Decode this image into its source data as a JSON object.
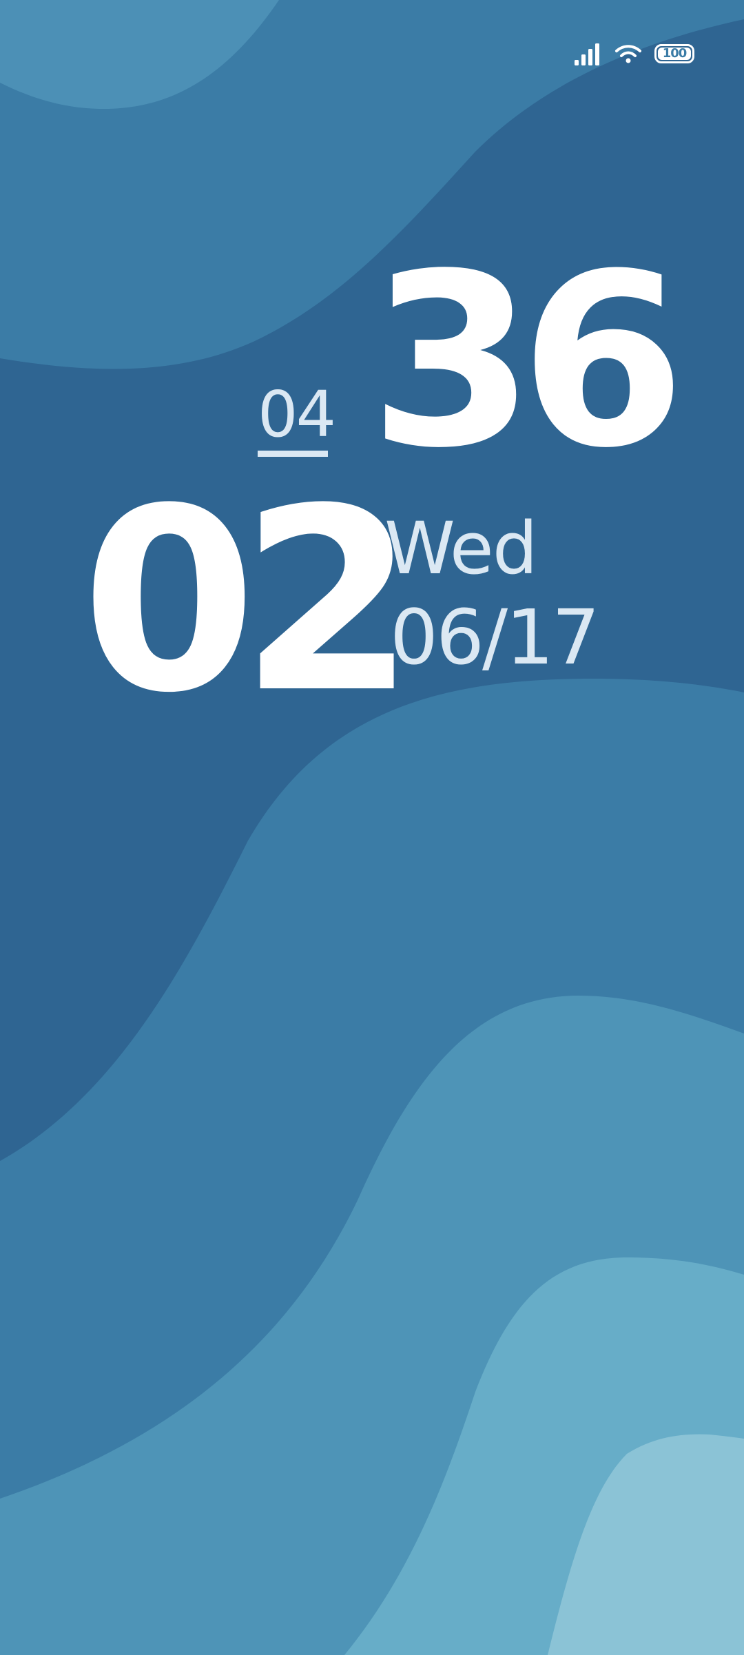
{
  "status_bar": {
    "battery_level": "100",
    "signal_icon": "signal-bars-icon",
    "wifi_icon": "wifi-icon",
    "battery_icon": "battery-icon"
  },
  "clock": {
    "hour": "02",
    "minute": "36",
    "small_number": "04",
    "weekday": "Wed",
    "date": "06/17"
  },
  "colors": {
    "wave_1": "#4c90b6",
    "wave_2": "#3b7ca6",
    "wave_3": "#2f6592",
    "wave_4": "#3b7ca6",
    "wave_5": "#4e94b7",
    "wave_6": "#67adc8",
    "wave_7": "#8bc3d6",
    "clock_text": "#ffffff",
    "secondary_text": "#dbe8f3"
  }
}
